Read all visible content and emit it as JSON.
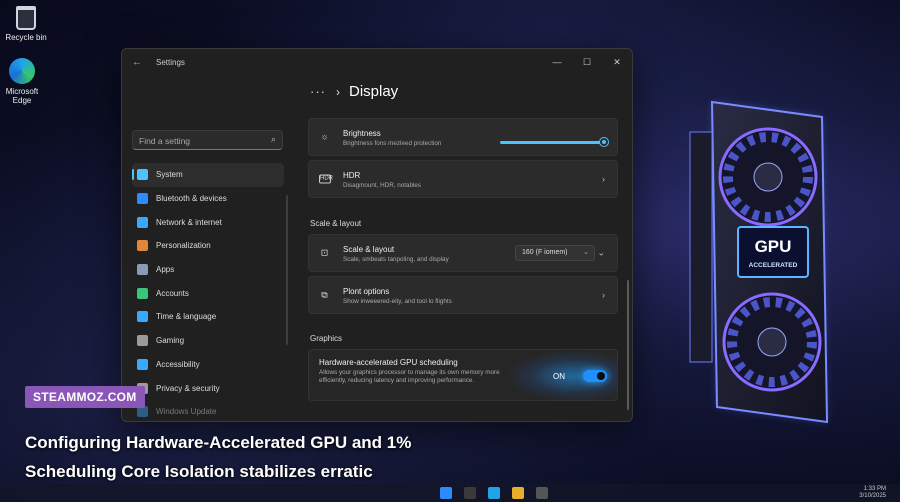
{
  "desktop": {
    "recycle_bin_label": "Recycle bin",
    "edge_label_line1": "Microsoft",
    "edge_label_line2": "Edge"
  },
  "window": {
    "title": "Settings",
    "controls": {
      "minimize": "—",
      "maximize": "☐",
      "close": "✕"
    }
  },
  "sidebar": {
    "search_placeholder": "Find a setting",
    "items": [
      {
        "label": "System",
        "color": "#4cc2ff"
      },
      {
        "label": "Bluetooth & devices",
        "color": "#2a8cff"
      },
      {
        "label": "Network & internet",
        "color": "#3aa8ff"
      },
      {
        "label": "Personalization",
        "color": "#e0863a"
      },
      {
        "label": "Apps",
        "color": "#8a9bb5"
      },
      {
        "label": "Accounts",
        "color": "#3cc47a"
      },
      {
        "label": "Time & language",
        "color": "#3aa8ff"
      },
      {
        "label": "Gaming",
        "color": "#9a9a9a"
      },
      {
        "label": "Accessibility",
        "color": "#3aa8ff"
      },
      {
        "label": "Privacy & security",
        "color": "#9a9a9a"
      },
      {
        "label": "Windows Update",
        "color": "#3aa8ff"
      }
    ]
  },
  "content": {
    "breadcrumb_dots": "···",
    "breadcrumb_chevron": "›",
    "page_title": "Display",
    "brightness": {
      "title": "Brightness",
      "subtitle": "Brightness fons mezleed protection",
      "level": 1.0
    },
    "hdr": {
      "title": "HDR",
      "subtitle": "Disagmount, HDR, notables"
    },
    "section_scale": "Scale & layout",
    "scale": {
      "title": "Scale & layout",
      "subtitle": "Scale, smbeats tanpoling, and display",
      "dropdown_value": "160 (F iomem)"
    },
    "plont": {
      "title": "Plont options",
      "subtitle": "Show inweeered-eity, and tool lo flights"
    },
    "section_graphics": "Graphics",
    "gpu": {
      "title": "Hardware-accelerated GPU scheduling",
      "subtitle": "Allows your graphics processor to manage its own memory more efficiently, reducing latency and improving performance.",
      "toggle_label": "ON",
      "toggle_state": true
    }
  },
  "gpu_image": {
    "line1": "GPU",
    "line2": "ACCELERATED"
  },
  "overlay": {
    "badge": "STEAMMOZ.COM",
    "caption_line1": "Configuring Hardware-Accelerated GPU and 1%",
    "caption_line2": "Scheduling Core Isolation stabilizes erratic"
  },
  "taskbar": {
    "time": "1:33 PM",
    "date": "3/10/2025"
  }
}
